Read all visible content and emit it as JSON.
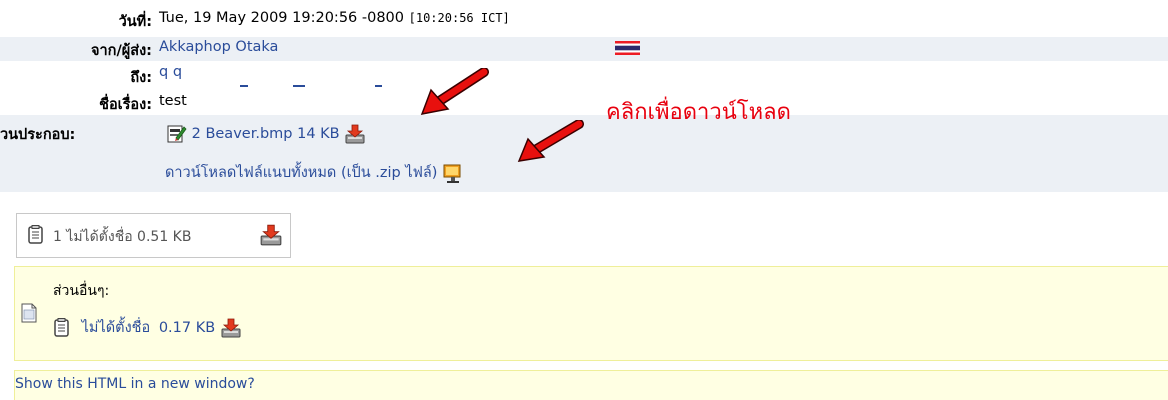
{
  "header": {
    "date": {
      "label": "วันที่:",
      "value": "Tue, 19 May 2009 19:20:56 -0800",
      "local": "[10:20:56 ICT]"
    },
    "from": {
      "label": "จาก/ผู้ส่ง:",
      "value": "Akkaphop Otaka"
    },
    "to": {
      "label": "ถึง:",
      "value": "q q"
    },
    "subject": {
      "label": "ชื่อเรื่อง:",
      "value": "test"
    },
    "attachments": {
      "label": "่วนประกอบ:",
      "file": {
        "name": "2 Beaver.bmp",
        "size": "14 KB"
      },
      "download_all": "ดาวน์โหลดไฟล์แนบทั้งหมด (เป็น .zip ไฟล์)"
    }
  },
  "annotation": {
    "text": "คลิกเพื่อดาวน์โหลด",
    "color": "#e8000e"
  },
  "unnamed_part": {
    "text": "1 ไม่ได้ตั้งชื่อ 0.51 KB"
  },
  "other_parts": {
    "heading": "ส่วนอื่นๆ:",
    "item": {
      "name": "ไม่ได้ตั้งชื่อ",
      "size": "0.17 KB"
    }
  },
  "html_link": "Show this HTML in a new window?",
  "colors": {
    "link": "#2a4c9a",
    "header_bg": "#ecf0f5",
    "yellow_bg": "#ffffe3",
    "annotation": "#e8000e"
  }
}
